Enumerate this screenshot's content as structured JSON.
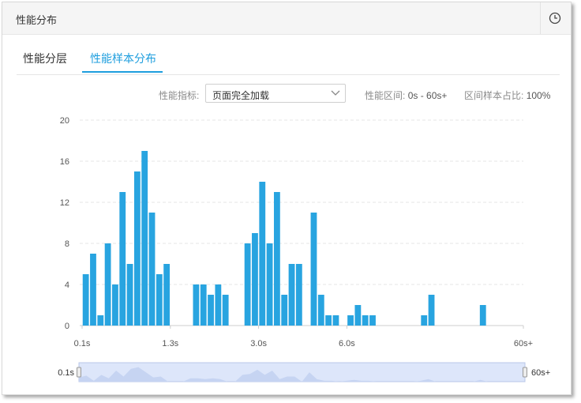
{
  "header": {
    "title": "性能分布",
    "history_icon": "clock-icon"
  },
  "tabs": [
    {
      "label": "性能分层",
      "active": false
    },
    {
      "label": "性能样本分布",
      "active": true
    }
  ],
  "filters": {
    "metric_label": "性能指标:",
    "metric_value": "页面完全加载",
    "range_label": "性能区间:",
    "range_value": "0s - 60s+",
    "ratio_label": "区间样本占比:",
    "ratio_value": "100%"
  },
  "colors": {
    "accent": "#1e9ede",
    "bar": "#28a4e0",
    "slider_fill": "#dde6fa",
    "slider_area": "#c6d4f2"
  },
  "chart_data": {
    "type": "bar",
    "x": [
      "0.1s",
      "",
      "",
      "",
      "",
      "",
      "",
      "",
      "",
      "",
      "",
      "",
      "1.3s",
      "",
      "",
      "",
      "",
      "",
      "",
      "",
      "",
      "",
      "",
      "",
      "3.0s",
      "",
      "",
      "",
      "",
      "",
      "",
      "",
      "",
      "",
      "",
      "",
      "6.0s",
      "",
      "",
      "",
      "",
      "",
      "",
      "",
      "",
      "",
      "",
      "",
      "",
      "",
      "",
      "",
      "",
      "",
      "",
      "",
      "",
      "",
      "",
      "",
      "60s+"
    ],
    "values": [
      5,
      7,
      1,
      8,
      4,
      13,
      6,
      15,
      17,
      11,
      5,
      6,
      0,
      0,
      0,
      4,
      4,
      3,
      4,
      3,
      0,
      0,
      8,
      9,
      14,
      8,
      13,
      3,
      6,
      6,
      0,
      11,
      3,
      1,
      1,
      0,
      1,
      2,
      1,
      1,
      0,
      0,
      0,
      0,
      0,
      0,
      1,
      3,
      0,
      0,
      0,
      0,
      0,
      0,
      2,
      0,
      0,
      0,
      0,
      0,
      0
    ],
    "tick_labels": [
      "0.1s",
      "1.3s",
      "3.0s",
      "6.0s",
      "60s+"
    ],
    "tick_indices": [
      0,
      12,
      24,
      36,
      60
    ],
    "ylim": [
      0,
      20
    ],
    "yticks": [
      0,
      4,
      8,
      12,
      16,
      20
    ],
    "grid": true,
    "slider": {
      "start_label": "0.1s",
      "end_label": "60s+"
    }
  }
}
